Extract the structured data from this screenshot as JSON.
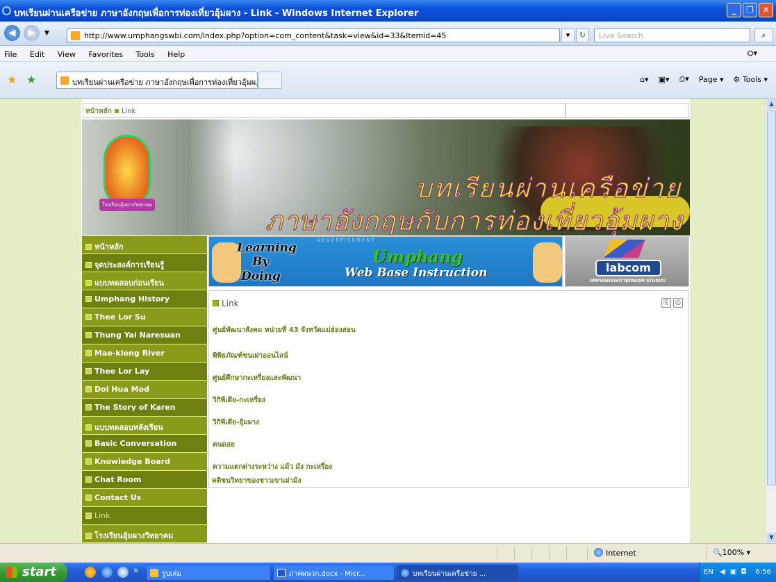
{
  "window": {
    "title": "บทเรียนผ่านเครือข่าย ภาษาอังกฤษเพื่อการท่องเที่ยวอุ้มผาง - Link - Windows Internet Explorer",
    "min": "_",
    "max": "❐",
    "close": "✕"
  },
  "address": {
    "url": "http://www.umphangswbi.com/index.php?option=com_content&task=view&id=33&Itemid=45",
    "search_placeholder": "Live Search"
  },
  "menu": [
    "File",
    "Edit",
    "View",
    "Favorites",
    "Tools",
    "Help"
  ],
  "tab": {
    "label": "บทเรียนผ่านเครือข่าย ภาษาอังกฤษเพื่อการท่องเที่ยวอุ้มผ...",
    "page_label": "Page",
    "tools_label": "Tools"
  },
  "breadcrumb": {
    "home": "หน้าหลัก",
    "current": "Link"
  },
  "banner": {
    "line1": "บทเรียนผ่านเครือข่าย",
    "line2": "ภาษาอังกฤษกับการท่องเที่ยวอุ้มผาง",
    "emblem_text": "โรงเรียนอุ้มผางวิทยาคม"
  },
  "sidebar": [
    "หน้าหลัก",
    "จุดประสงค์การเรียนรู้",
    "แบบทดสอบก่อนเรียน",
    "Umphang History",
    "Thee Lor Su",
    "Thung Yai Naresuan",
    "Mae-klong River",
    "Thee Lor Lay",
    "Doi Hua Mod",
    "The Story of Karen",
    "แบบทดสอบหลังเรียน",
    "Basic Conversation",
    "Knowledge Board",
    "Chat Room",
    "Contact Us",
    "Link",
    "โรงเรียนอุ้มผางวิทยาคม"
  ],
  "ad": {
    "label": "ADVERTISEMENT",
    "l1": "Learning",
    "l2": "By",
    "l3": "Doing",
    "r1": "Umphang",
    "r2": "Web Base Instruction",
    "lab_text": "labcom",
    "lab_sub": "UMPHANGWITTAYAKOM STUDIO!"
  },
  "article": {
    "title": "Link",
    "links": [
      "ศูนย์พัฒนาสังคม หน่วยที่ 43 จังหวัดแม่ฮ่องสอน",
      "พิพิธภัณฑ์ชนเผ่าออนไลน์",
      "ศูนย์ศึกษากะเหรี่ยงและพัฒนา",
      "วิกิพีเดีย-กะเหรี่ยง",
      "วิกิพีเดีย-อุ้มผาง",
      "คนดอย",
      "ความแตกต่างระหว่าง แม้ว มัง กะเหรี่ยง",
      "คติชนวิทยาของชาวเขาเผ่าม้ง"
    ]
  },
  "status": {
    "zone": "Internet",
    "zoom": "100%"
  },
  "taskbar": {
    "start": "start",
    "tasks": [
      "รูปเล่ม",
      "ภาคผนวก.docx - Micr...",
      "บทเรียนผ่านเครือข่าย ..."
    ],
    "lang": "EN",
    "clock": "6:56"
  }
}
